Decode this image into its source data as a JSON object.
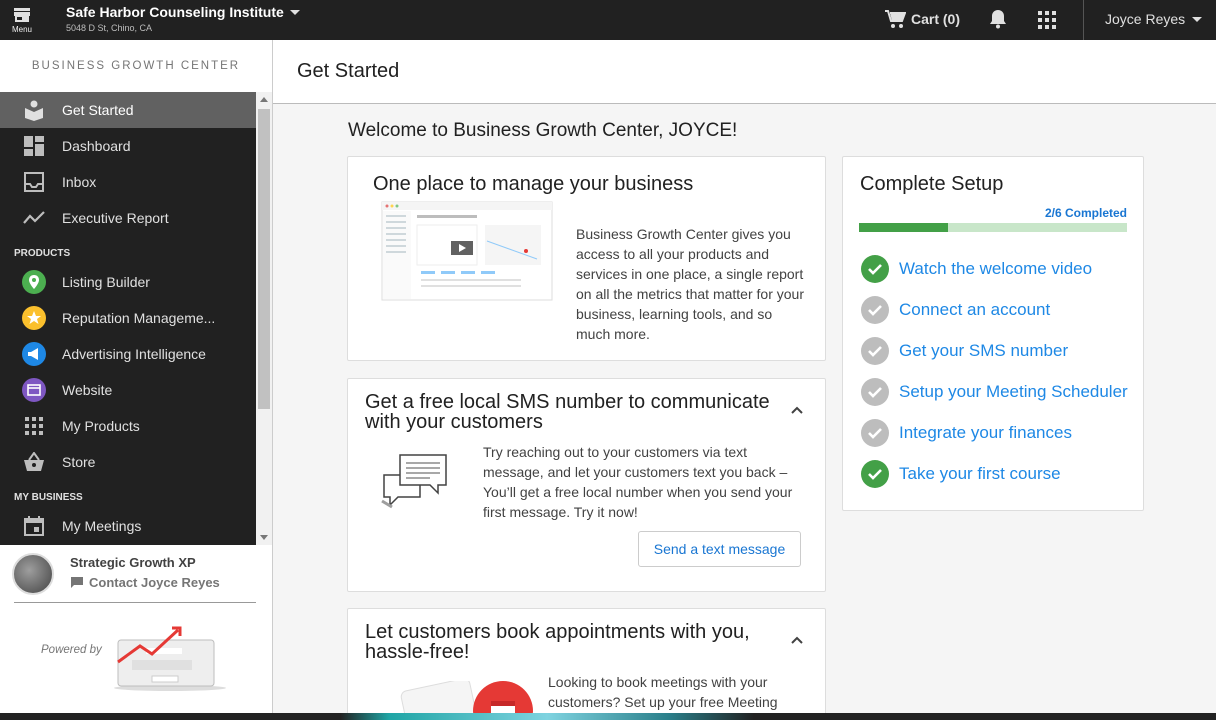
{
  "topbar": {
    "menu_label": "Menu",
    "business_name": "Safe Harbor Counseling Institute",
    "business_address": "5048 D St, Chino, CA",
    "cart_label": "Cart (0)",
    "user_name": "Joyce Reyes"
  },
  "sidebar": {
    "title": "BUSINESS GROWTH CENTER",
    "items_top": [
      {
        "label": "Get Started",
        "icon": "get-started-icon"
      },
      {
        "label": "Dashboard",
        "icon": "dashboard-icon"
      },
      {
        "label": "Inbox",
        "icon": "inbox-icon"
      },
      {
        "label": "Executive Report",
        "icon": "trending-icon"
      }
    ],
    "section_products": "PRODUCTS",
    "products": [
      {
        "label": "Listing Builder",
        "icon": "listing-builder-icon",
        "color": "#4caf50"
      },
      {
        "label": "Reputation Manageme...",
        "icon": "reputation-icon",
        "color": "#fbc02d"
      },
      {
        "label": "Advertising Intelligence",
        "icon": "advertising-icon",
        "color": "#1e88e5"
      },
      {
        "label": "Website",
        "icon": "website-icon",
        "color": "#7e57c2"
      },
      {
        "label": "My Products",
        "icon": "grid-icon"
      },
      {
        "label": "Store",
        "icon": "store-icon"
      }
    ],
    "section_business": "MY BUSINESS",
    "business": [
      {
        "label": "My Meetings",
        "icon": "calendar-icon"
      }
    ],
    "partner_name": "Strategic Growth XP",
    "partner_contact": "Contact Joyce Reyes",
    "powered_by": "Powered by"
  },
  "main": {
    "page_title": "Get Started",
    "welcome": "Welcome to Business Growth Center, JOYCE!",
    "card_manage": {
      "title": "One place to manage your business",
      "body": "Business Growth Center gives you access to all your products and services in one place, a single report on all the metrics that matter for your business, learning tools, and so much more."
    },
    "card_sms": {
      "title": "Get a free local SMS number to communicate with your customers",
      "body": "Try reaching out to your customers via text message, and let your customers text you back – You’ll get a free local number when you send your first message. Try it now!",
      "button": "Send a text message"
    },
    "card_meetings": {
      "title": "Let customers book appointments with you, hassle-free!",
      "body": "Looking to book meetings with your customers? Set up your free Meeting"
    },
    "setup": {
      "title": "Complete Setup",
      "completed_label": "2/6 Completed",
      "progress": 0.333,
      "steps": [
        {
          "label": "Watch the welcome video",
          "done": true
        },
        {
          "label": "Connect an account",
          "done": false
        },
        {
          "label": "Get your SMS number",
          "done": false
        },
        {
          "label": "Setup your Meeting Scheduler",
          "done": false
        },
        {
          "label": "Integrate your finances",
          "done": false
        },
        {
          "label": "Take your first course",
          "done": true
        }
      ]
    }
  },
  "colors": {
    "topbar": "#212121",
    "accent_blue": "#1e88e5",
    "success_green": "#43a047",
    "pending_grey": "#bdbdbd"
  }
}
